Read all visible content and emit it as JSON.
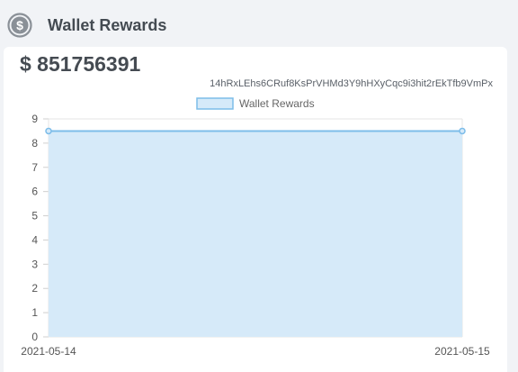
{
  "header": {
    "title": "Wallet Rewards",
    "icon": "dollar-coin-icon"
  },
  "card": {
    "amount": "$ 851756391",
    "address": "14hRxLEhs6CRuf8KsPrVHMd3Y9hHXyCqc9i3hit2rEkTfb9VmPx"
  },
  "colors": {
    "fill": "#d6eaf9",
    "line": "#7dbde9",
    "grid": "#e6e6e6"
  },
  "chart_data": {
    "type": "area",
    "x": [
      "2021-05-14",
      "2021-05-15"
    ],
    "series": [
      {
        "name": "Wallet Rewards",
        "values": [
          8.5,
          8.5
        ]
      }
    ],
    "ylim": [
      0,
      9
    ],
    "yticks": [
      0,
      1,
      2,
      3,
      4,
      5,
      6,
      7,
      8,
      9
    ],
    "grid": true,
    "legend": "top-center"
  }
}
